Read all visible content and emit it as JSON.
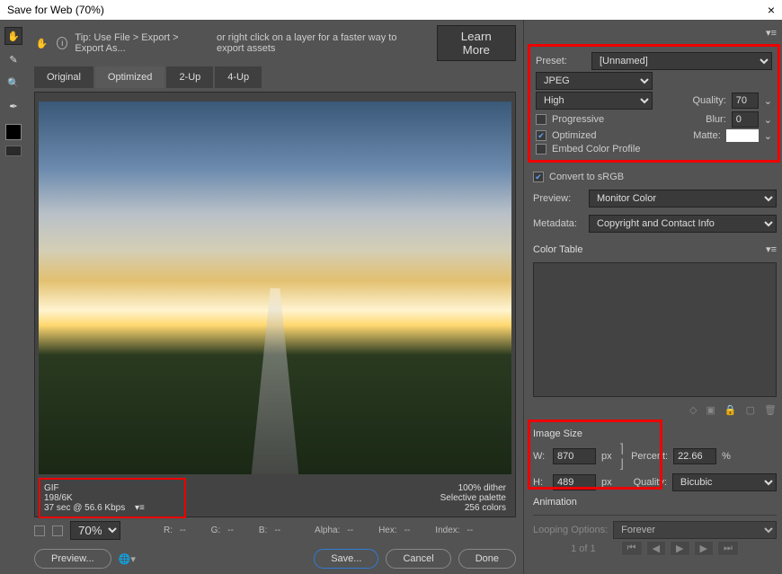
{
  "titlebar": {
    "title": "Save for Web (70%)",
    "close": "×"
  },
  "tipbar": {
    "tip_prefix": "Tip: Use File > Export > Export As...",
    "tip_suffix": "or right click on a layer for a faster way to export assets",
    "learn": "Learn More"
  },
  "tabs": {
    "original": "Original",
    "optimized": "Optimized",
    "two_up": "2-Up",
    "four_up": "4-Up"
  },
  "preview_info": {
    "format": "GIF",
    "size_line": "198/6K",
    "time_line": "37 sec @ 56.6 Kbps",
    "dither": "100% dither",
    "palette": "Selective palette",
    "colors": "256 colors"
  },
  "statusbar": {
    "zoom": "70%",
    "r": "R:",
    "g": "G:",
    "b": "B:",
    "alpha": "Alpha:",
    "hex": "Hex:",
    "index": "Index:",
    "dash": "--"
  },
  "buttons": {
    "preview": "Preview...",
    "save": "Save...",
    "cancel": "Cancel",
    "done": "Done"
  },
  "right": {
    "preset_lbl": "Preset:",
    "preset_val": "[Unnamed]",
    "format": "JPEG",
    "quality_preset": "High",
    "progressive": "Progressive",
    "optimized": "Optimized",
    "embed": "Embed Color Profile",
    "quality_lbl": "Quality:",
    "quality_val": "70",
    "blur_lbl": "Blur:",
    "blur_val": "0",
    "matte_lbl": "Matte:",
    "convert_srgb": "Convert to sRGB",
    "preview_lbl": "Preview:",
    "preview_val": "Monitor Color",
    "metadata_lbl": "Metadata:",
    "metadata_val": "Copyright and Contact Info",
    "color_table": "Color Table",
    "image_size": "Image Size",
    "w_lbl": "W:",
    "w_val": "870",
    "h_lbl": "H:",
    "h_val": "489",
    "px": "px",
    "percent_lbl": "Percent:",
    "percent_val": "22.66",
    "percent_sym": "%",
    "iq_lbl": "Quality:",
    "iq_val": "Bicubic",
    "animation": "Animation",
    "loop_lbl": "Looping Options:",
    "loop_val": "Forever",
    "frames": "1 of 1"
  }
}
